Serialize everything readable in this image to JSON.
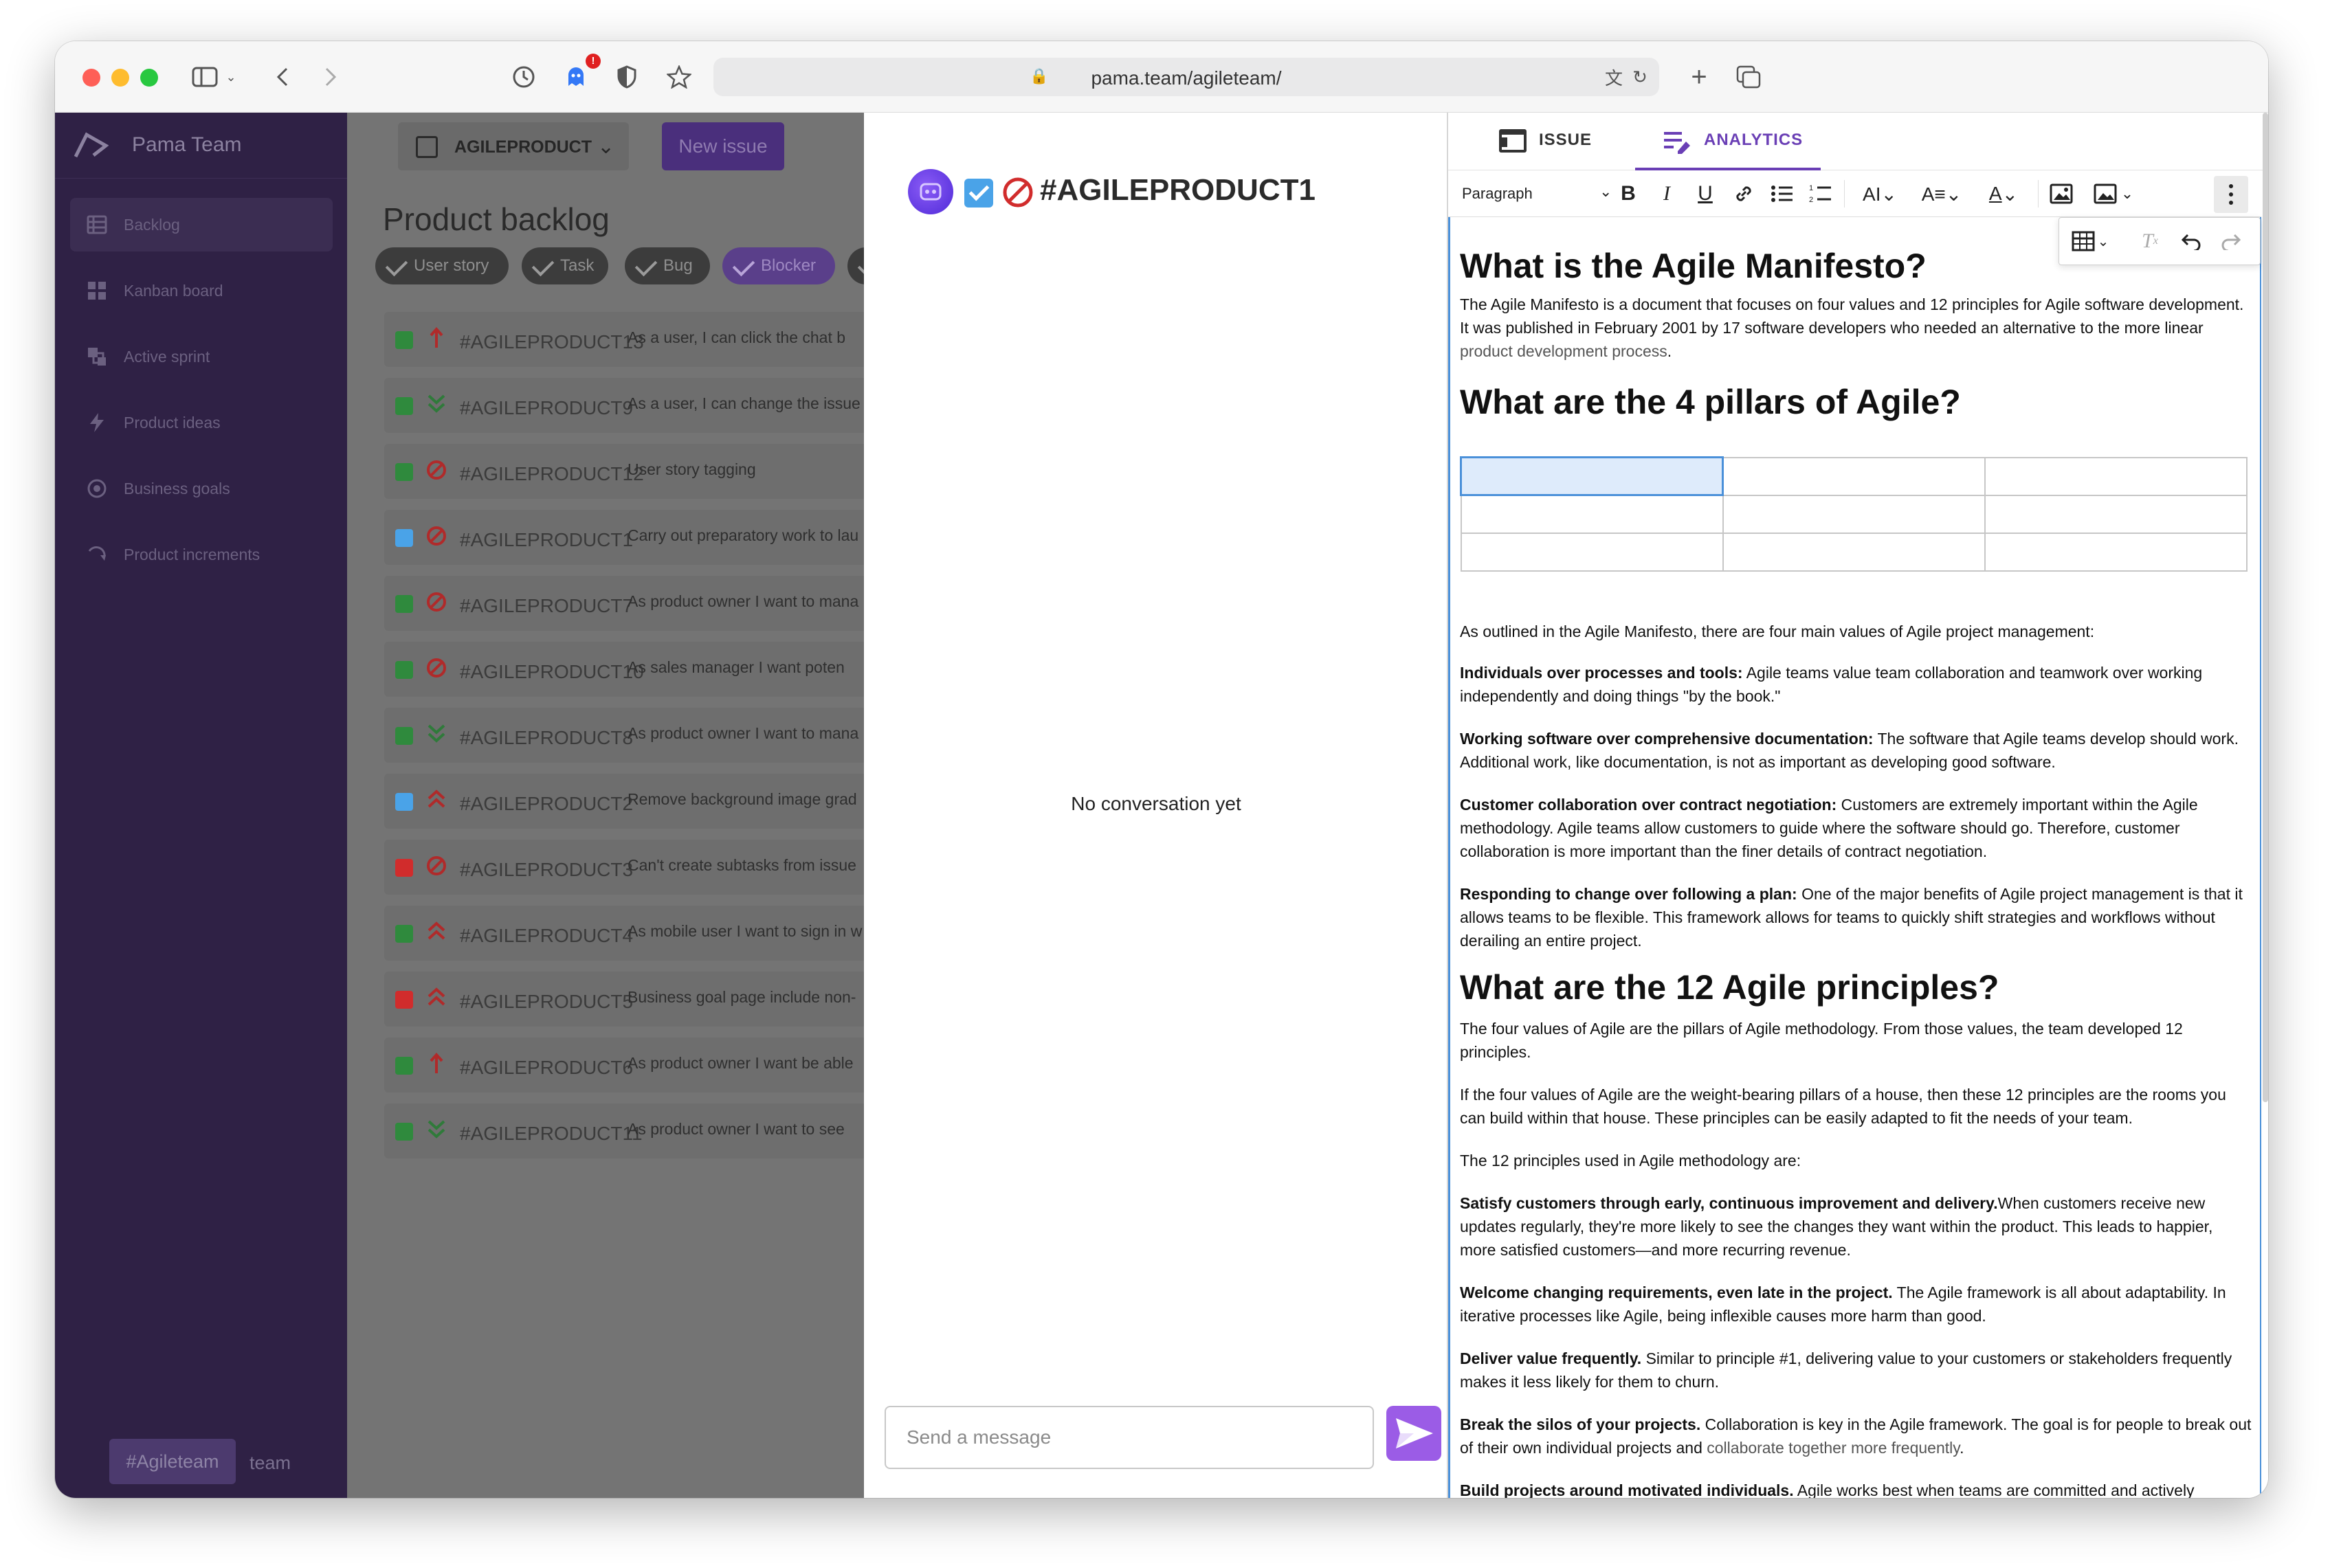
{
  "browser": {
    "url": "pama.team/agileteam/",
    "notification_count": "!"
  },
  "sidebar": {
    "title": "Pama Team",
    "items": [
      {
        "label": "Backlog"
      },
      {
        "label": "Kanban board"
      },
      {
        "label": "Active sprint"
      },
      {
        "label": "Product ideas"
      },
      {
        "label": "Business goals"
      },
      {
        "label": "Product increments"
      }
    ],
    "team_badge": "#Agileteam",
    "team_suffix": "team"
  },
  "backlog": {
    "project": "AGILEPRODUCT",
    "new_issue": "New issue",
    "title": "Product backlog",
    "filters": [
      "User story",
      "Task",
      "Bug",
      "Blocker"
    ],
    "issues": [
      {
        "key": "#AGILEPRODUCT13",
        "summary": "As a user, I can click the chat b",
        "type": "story",
        "priority": "up"
      },
      {
        "key": "#AGILEPRODUCT9",
        "summary": "As a user, I can change the issue",
        "type": "story",
        "priority": "lowest"
      },
      {
        "key": "#AGILEPRODUCT12",
        "summary": "User story tagging",
        "type": "story",
        "priority": "blocker"
      },
      {
        "key": "#AGILEPRODUCT1",
        "summary": "Carry out preparatory work to lau",
        "type": "task",
        "priority": "blocker"
      },
      {
        "key": "#AGILEPRODUCT7",
        "summary": "As product owner I want to mana",
        "type": "story",
        "priority": "blocker"
      },
      {
        "key": "#AGILEPRODUCT10",
        "summary": "As sales manager I want poten",
        "type": "story",
        "priority": "blocker"
      },
      {
        "key": "#AGILEPRODUCT8",
        "summary": "As product owner I want to mana",
        "type": "story",
        "priority": "lowest"
      },
      {
        "key": "#AGILEPRODUCT2",
        "summary": "Remove background image grad",
        "type": "task",
        "priority": "highest"
      },
      {
        "key": "#AGILEPRODUCT3",
        "summary": "Can't create subtasks from issue",
        "type": "bug",
        "priority": "blocker"
      },
      {
        "key": "#AGILEPRODUCT4",
        "summary": "As mobile user I want to sign in w",
        "type": "story",
        "priority": "highest"
      },
      {
        "key": "#AGILEPRODUCT5",
        "summary": "Business goal page include non-",
        "type": "bug",
        "priority": "highest"
      },
      {
        "key": "#AGILEPRODUCT6",
        "summary": "As product owner I want be able",
        "type": "story",
        "priority": "up"
      },
      {
        "key": "#AGILEPRODUCT11",
        "summary": "As product owner I want to see",
        "type": "story",
        "priority": "lowest"
      }
    ]
  },
  "chat": {
    "issue_key": "#AGILEPRODUCT1",
    "empty_text": "No conversation yet",
    "input_placeholder": "Send a message"
  },
  "editor": {
    "tabs": [
      "ISSUE",
      "ANALYTICS"
    ],
    "active_tab": "ANALYTICS",
    "block_style": "Paragraph",
    "doc": {
      "h1": "What is the Agile Manifesto?",
      "p1": "The Agile Manifesto is a document that focuses on four values and 12 principles for Agile software development. It was published in February 2001 by 17 software developers who needed an alternative to the more linear ",
      "p1_link": "product development process",
      "p1_end": ".",
      "h2": "What are the 4 pillars of Agile?",
      "p2": "As outlined in the Agile Manifesto, there are four main values of Agile project management:",
      "v1_b": "Individuals over processes and tools:",
      "v1": " Agile teams value team collaboration and teamwork over working independently and doing things \"by the book.\"",
      "v2_b": "Working software over comprehensive documentation:",
      "v2": " The software that Agile teams develop should work. Additional work, like documentation, is not as important as developing good software.",
      "v3_b": "Customer collaboration over contract negotiation:",
      "v3": " Customers are extremely important within the Agile methodology. Agile teams allow customers to guide where the software should go. Therefore, customer collaboration is more important than the finer details of contract negotiation.",
      "v4_b": "Responding to change over following a plan:",
      "v4": " One of the major benefits of Agile project management is that it allows teams to be flexible. This framework allows for teams to quickly shift strategies and workflows without derailing an entire project.",
      "h3": "What are the 12 Agile principles?",
      "p3": "The four values of Agile are the pillars of Agile methodology. From those values, the team developed 12 principles.",
      "p4": "If the four values of Agile are the weight-bearing pillars of a house, then these 12 principles are the rooms you can build within that house. These principles can be easily adapted to fit the needs of your team.",
      "p5": "The 12 principles used in Agile methodology are:",
      "pr1_b": "Satisfy customers through early, continuous improvement and delivery.",
      "pr1": "When customers receive new updates regularly, they're more likely to see the changes they want within the product. This leads to happier, more satisfied customers—and more recurring revenue.",
      "pr2_b": "Welcome changing requirements, even late in the project.",
      "pr2": " The Agile framework is all about adaptability. In iterative processes like Agile, being inflexible causes more harm than good.",
      "pr3_b": "Deliver value frequently.",
      "pr3": " Similar to principle #1, delivering value to your customers or stakeholders frequently makes it less likely for them to churn.",
      "pr4_b": "Break the silos of your projects.",
      "pr4": " Collaboration is key in the Agile framework. The goal is for people to break out of their own individual projects and ",
      "pr4_link": "collaborate together more frequently",
      "pr4_end": ".",
      "pr5_b": "Build projects around motivated individuals.",
      "pr5": " Agile works best when teams are committed and actively"
    }
  }
}
